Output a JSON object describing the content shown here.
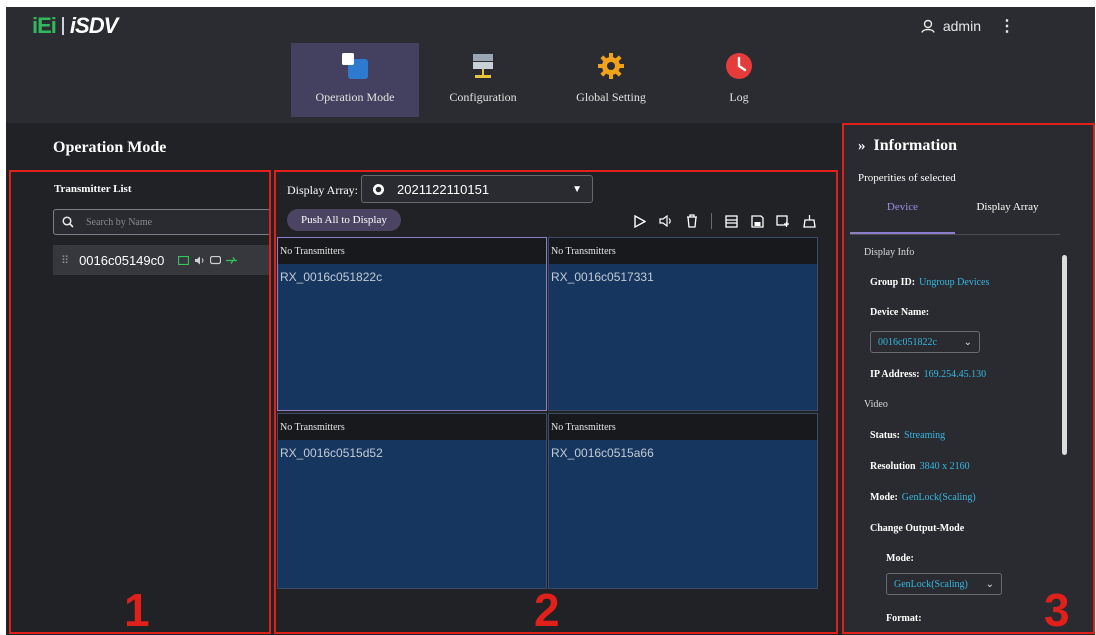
{
  "header": {
    "brand_ie": "iEi",
    "brand_name": "iSDV",
    "user": "admin",
    "more_menu": "⋮"
  },
  "nav": [
    {
      "label": "Operation Mode",
      "icon": "operation-mode-icon",
      "active": true
    },
    {
      "label": "Configuration",
      "icon": "configuration-icon",
      "active": false
    },
    {
      "label": "Global Setting",
      "icon": "gear-icon",
      "active": false
    },
    {
      "label": "Log",
      "icon": "clock-icon",
      "active": false
    }
  ],
  "page_title": "Operation Mode",
  "panel1": {
    "header": "Transmitter List",
    "search_placeholder": "Search by Name",
    "transmitters": [
      {
        "name": "0016c05149c0"
      }
    ]
  },
  "panel2": {
    "display_array_label": "Display Array:",
    "display_array_value": "2021122110151",
    "push_all_label": "Push All to Display",
    "cells": [
      {
        "header": "No Transmitters",
        "receiver": "RX_0016c051822c",
        "selected": true
      },
      {
        "header": "No Transmitters",
        "receiver": "RX_0016c0517331",
        "selected": false
      },
      {
        "header": "No Transmitters",
        "receiver": "RX_0016c0515d52",
        "selected": false
      },
      {
        "header": "No Transmitters",
        "receiver": "RX_0016c0515a66",
        "selected": false
      }
    ]
  },
  "info": {
    "title": "Information",
    "subtitle": "Properities of selected",
    "tabs": [
      "Device",
      "Display Array"
    ],
    "display_info_label": "Display Info",
    "group_id_label": "Group ID:",
    "group_id_value": "Ungroup Devices",
    "device_name_label": "Device Name:",
    "device_name_value": "0016c051822c",
    "ip_label": "IP Address:",
    "ip_value": "169.254.45.130",
    "video_label": "Video",
    "status_label": "Status:",
    "status_value": "Streaming",
    "resolution_label": "Resolution",
    "resolution_value": "3840 x 2160",
    "mode_label": "Mode:",
    "mode_value": "GenLock(Scaling)",
    "change_output_label": "Change Output-Mode",
    "mode2_label": "Mode:",
    "mode2_value": "GenLock(Scaling)",
    "format_label": "Format:"
  },
  "annotations": [
    "1",
    "2",
    "3"
  ],
  "colors": {
    "background": "#212226",
    "header": "#2b2c31",
    "nav_active": "#44405f",
    "cell_blue": "#16365f",
    "accent_link": "#35b7e2",
    "annotation_red": "#e0201b",
    "brand_green": "#31b75c"
  }
}
